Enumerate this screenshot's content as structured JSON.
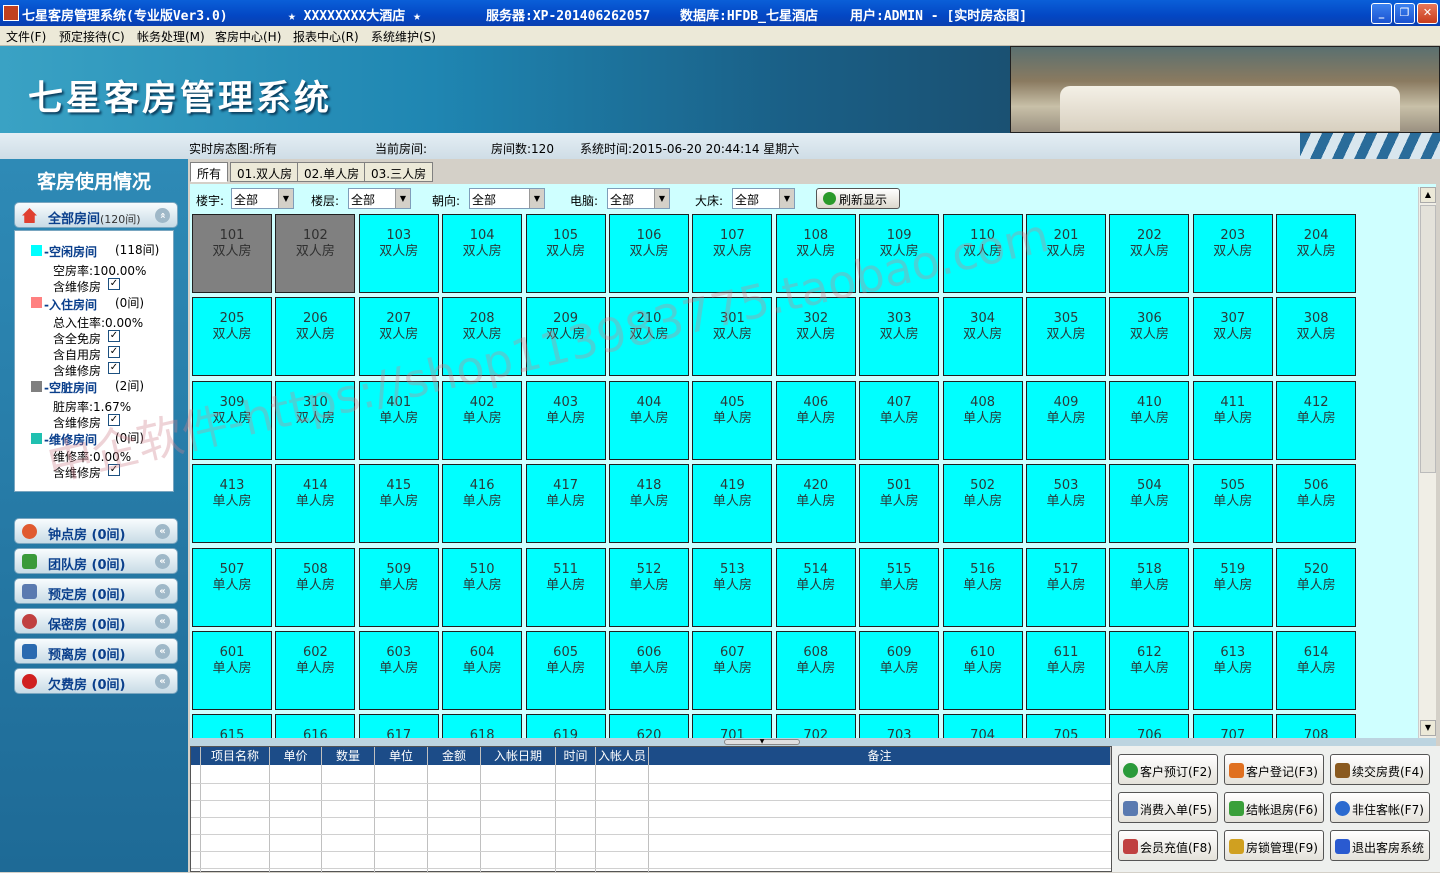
{
  "window": {
    "app_title": "七星客房管理系统(专业版Ver3.0)",
    "hotel": "★ XXXXXXXX大酒店 ★",
    "server": "服务器:XP-201406262057",
    "database": "数据库:HFDB_七星酒店",
    "user": "用户:ADMIN - [实时房态图]",
    "minimize": "_",
    "restore": "❐",
    "close": "✕"
  },
  "menu": [
    "文件(F)",
    "预定接待(C)",
    "帐务处理(M)",
    "客房中心(H)",
    "报表中心(R)",
    "系统维护(S)"
  ],
  "banner": {
    "logo": "七星客房管理系统"
  },
  "info": {
    "view": "实时房态图:所有",
    "current_room": "当前房间:",
    "room_count": "房间数:120",
    "system_time": "系统时间:2015-06-20 20:44:14  星期六"
  },
  "sidebar": {
    "title": "客房使用情况",
    "all_label": "全部房间",
    "all_count": "(120间)",
    "vacant_label": "-空闲房间",
    "vacant_count": "(118间)",
    "vacant_rate": "空房率:100.00%",
    "occupied_label": "-入住房间",
    "occupied_count": "(0间)",
    "occupied_rate": "总入住率:0.00%",
    "dirty_label": "-空脏房间",
    "dirty_count": "(2间)",
    "dirty_rate": "脏房率:1.67%",
    "repair_label": "-维修房间",
    "repair_count": "(0间)",
    "repair_rate": "维修率:0.00%",
    "include_repair": "含维修房",
    "include_free": "含全免房",
    "include_self": "含自用房",
    "check": "✓",
    "groups": [
      {
        "label": "钟点房",
        "count": "(0间)",
        "color": "#e05a30"
      },
      {
        "label": "团队房",
        "count": "(0间)",
        "color": "#3a9a3a"
      },
      {
        "label": "预定房",
        "count": "(0间)",
        "color": "#5a7ab0"
      },
      {
        "label": "保密房",
        "count": "(0间)",
        "color": "#c04040"
      },
      {
        "label": "预离房",
        "count": "(0间)",
        "color": "#2a6ab0"
      },
      {
        "label": "欠费房",
        "count": "(0间)",
        "color": "#d02020"
      }
    ],
    "arrow": "«"
  },
  "tabs": [
    "所有",
    "01.双人房",
    "02.单人房",
    "03.三人房"
  ],
  "filters": {
    "building": "楼宇:",
    "building_value": "全部",
    "floor": "楼层:",
    "floor_value": "全部",
    "facing": "朝向:",
    "facing_value": "全部",
    "computer": "电脑:",
    "computer_value": "全部",
    "bigbed": "大床:",
    "bigbed_value": "全部",
    "refresh": "刷新显示"
  },
  "rooms": [
    {
      "no": "101",
      "type": "双人房",
      "status": "dirty"
    },
    {
      "no": "102",
      "type": "双人房",
      "status": "dirty"
    },
    {
      "no": "103",
      "type": "双人房"
    },
    {
      "no": "104",
      "type": "双人房"
    },
    {
      "no": "105",
      "type": "双人房"
    },
    {
      "no": "106",
      "type": "双人房"
    },
    {
      "no": "107",
      "type": "双人房"
    },
    {
      "no": "108",
      "type": "双人房"
    },
    {
      "no": "109",
      "type": "双人房"
    },
    {
      "no": "110",
      "type": "双人房"
    },
    {
      "no": "201",
      "type": "双人房"
    },
    {
      "no": "202",
      "type": "双人房"
    },
    {
      "no": "203",
      "type": "双人房"
    },
    {
      "no": "204",
      "type": "双人房"
    },
    {
      "no": "205",
      "type": "双人房"
    },
    {
      "no": "206",
      "type": "双人房"
    },
    {
      "no": "207",
      "type": "双人房"
    },
    {
      "no": "208",
      "type": "双人房"
    },
    {
      "no": "209",
      "type": "双人房"
    },
    {
      "no": "210",
      "type": "双人房"
    },
    {
      "no": "301",
      "type": "双人房"
    },
    {
      "no": "302",
      "type": "双人房"
    },
    {
      "no": "303",
      "type": "双人房"
    },
    {
      "no": "304",
      "type": "双人房"
    },
    {
      "no": "305",
      "type": "双人房"
    },
    {
      "no": "306",
      "type": "双人房"
    },
    {
      "no": "307",
      "type": "双人房"
    },
    {
      "no": "308",
      "type": "双人房"
    },
    {
      "no": "309",
      "type": "双人房"
    },
    {
      "no": "310",
      "type": "双人房"
    },
    {
      "no": "401",
      "type": "单人房"
    },
    {
      "no": "402",
      "type": "单人房"
    },
    {
      "no": "403",
      "type": "单人房"
    },
    {
      "no": "404",
      "type": "单人房"
    },
    {
      "no": "405",
      "type": "单人房"
    },
    {
      "no": "406",
      "type": "单人房"
    },
    {
      "no": "407",
      "type": "单人房"
    },
    {
      "no": "408",
      "type": "单人房"
    },
    {
      "no": "409",
      "type": "单人房"
    },
    {
      "no": "410",
      "type": "单人房"
    },
    {
      "no": "411",
      "type": "单人房"
    },
    {
      "no": "412",
      "type": "单人房"
    },
    {
      "no": "413",
      "type": "单人房"
    },
    {
      "no": "414",
      "type": "单人房"
    },
    {
      "no": "415",
      "type": "单人房"
    },
    {
      "no": "416",
      "type": "单人房"
    },
    {
      "no": "417",
      "type": "单人房"
    },
    {
      "no": "418",
      "type": "单人房"
    },
    {
      "no": "419",
      "type": "单人房"
    },
    {
      "no": "420",
      "type": "单人房"
    },
    {
      "no": "501",
      "type": "单人房"
    },
    {
      "no": "502",
      "type": "单人房"
    },
    {
      "no": "503",
      "type": "单人房"
    },
    {
      "no": "504",
      "type": "单人房"
    },
    {
      "no": "505",
      "type": "单人房"
    },
    {
      "no": "506",
      "type": "单人房"
    },
    {
      "no": "507",
      "type": "单人房"
    },
    {
      "no": "508",
      "type": "单人房"
    },
    {
      "no": "509",
      "type": "单人房"
    },
    {
      "no": "510",
      "type": "单人房"
    },
    {
      "no": "511",
      "type": "单人房"
    },
    {
      "no": "512",
      "type": "单人房"
    },
    {
      "no": "513",
      "type": "单人房"
    },
    {
      "no": "514",
      "type": "单人房"
    },
    {
      "no": "515",
      "type": "单人房"
    },
    {
      "no": "516",
      "type": "单人房"
    },
    {
      "no": "517",
      "type": "单人房"
    },
    {
      "no": "518",
      "type": "单人房"
    },
    {
      "no": "519",
      "type": "单人房"
    },
    {
      "no": "520",
      "type": "单人房"
    },
    {
      "no": "601",
      "type": "单人房"
    },
    {
      "no": "602",
      "type": "单人房"
    },
    {
      "no": "603",
      "type": "单人房"
    },
    {
      "no": "604",
      "type": "单人房"
    },
    {
      "no": "605",
      "type": "单人房"
    },
    {
      "no": "606",
      "type": "单人房"
    },
    {
      "no": "607",
      "type": "单人房"
    },
    {
      "no": "608",
      "type": "单人房"
    },
    {
      "no": "609",
      "type": "单人房"
    },
    {
      "no": "610",
      "type": "单人房"
    },
    {
      "no": "611",
      "type": "单人房"
    },
    {
      "no": "612",
      "type": "单人房"
    },
    {
      "no": "613",
      "type": "单人房"
    },
    {
      "no": "614",
      "type": "单人房"
    },
    {
      "no": "615",
      "type": ""
    },
    {
      "no": "616",
      "type": ""
    },
    {
      "no": "617",
      "type": ""
    },
    {
      "no": "618",
      "type": ""
    },
    {
      "no": "619",
      "type": ""
    },
    {
      "no": "620",
      "type": ""
    },
    {
      "no": "701",
      "type": ""
    },
    {
      "no": "702",
      "type": ""
    },
    {
      "no": "703",
      "type": ""
    },
    {
      "no": "704",
      "type": ""
    },
    {
      "no": "705",
      "type": ""
    },
    {
      "no": "706",
      "type": ""
    },
    {
      "no": "707",
      "type": ""
    },
    {
      "no": "708",
      "type": ""
    }
  ],
  "table": {
    "columns": [
      "项目名称",
      "单价",
      "数量",
      "单位",
      "金额",
      "入帐日期",
      "时间",
      "入帐人员",
      "备注"
    ]
  },
  "actions": [
    {
      "label": "客户预订(F2)",
      "color": "#2a9a3a"
    },
    {
      "label": "客户登记(F3)",
      "color": "#e07020"
    },
    {
      "label": "续交房费(F4)",
      "color": "#8a5a20"
    },
    {
      "label": "消费入单(F5)",
      "color": "#5a7ab0"
    },
    {
      "label": "结帐退房(F6)",
      "color": "#3aa03a"
    },
    {
      "label": "非住客帐(F7)",
      "color": "#2a6ad0"
    },
    {
      "label": "会员充值(F8)",
      "color": "#c04040"
    },
    {
      "label": "房锁管理(F9)",
      "color": "#d0a020"
    },
    {
      "label": "退出客房系统",
      "color": "#2a5ad0"
    }
  ],
  "watermark": "中企软件-https://shop113983775.taobao.com",
  "scroll": {
    "up": "▲",
    "down": "▼",
    "handle": "▼"
  }
}
